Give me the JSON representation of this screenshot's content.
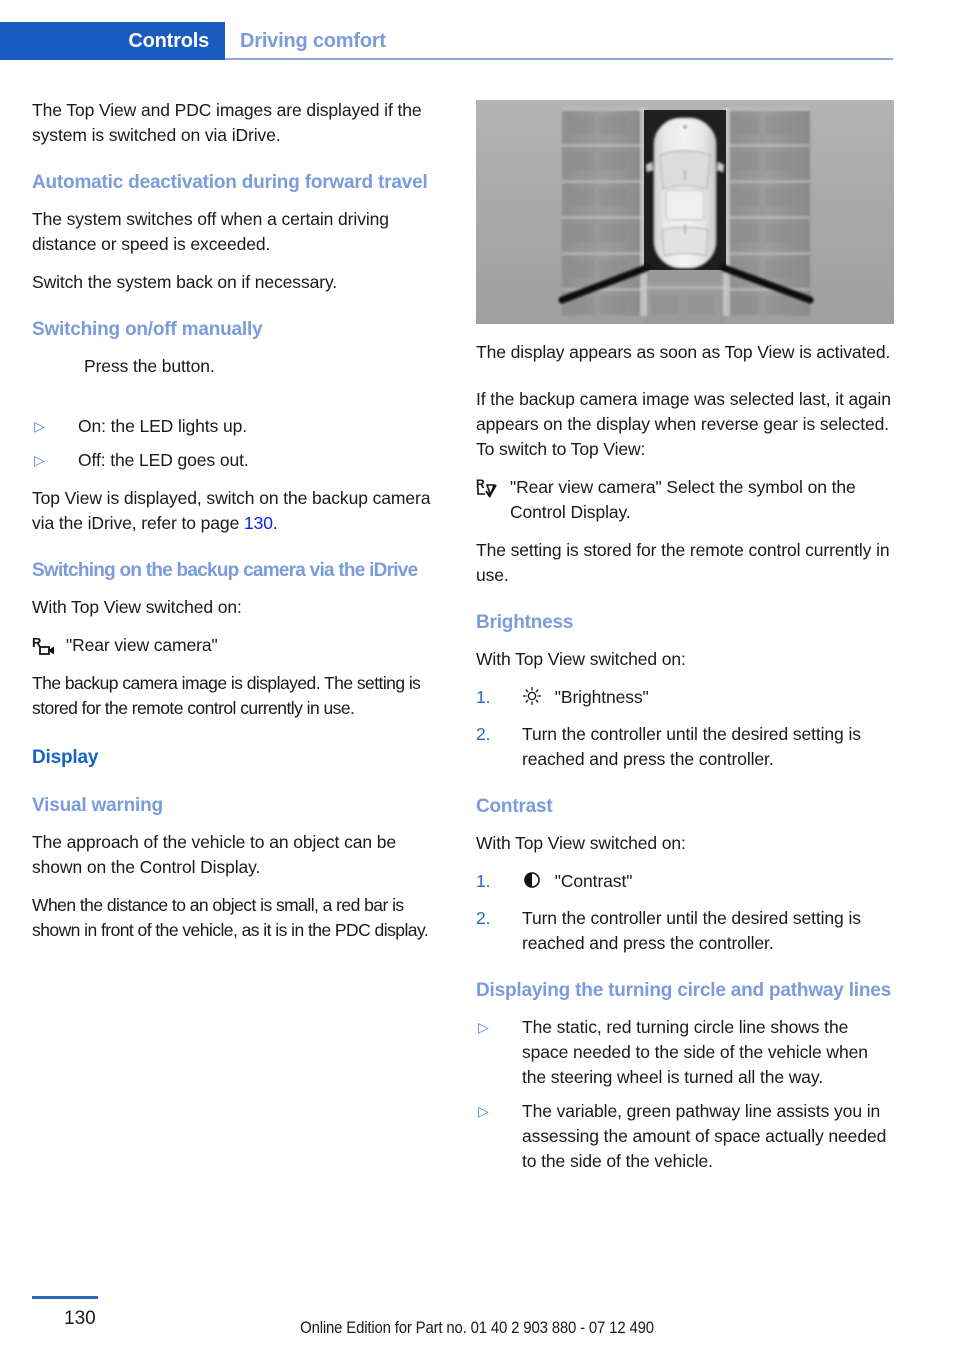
{
  "header": {
    "tab_label": "Controls",
    "section_label": "Driving comfort"
  },
  "left_column": {
    "intro_paragraph": "The Top View and PDC images are displayed if the system is switched on via iDrive.",
    "auto_deactivation": {
      "heading": "Automatic deactivation during forward travel",
      "paragraph_1": "The system switches off when a certain driving distance or speed is exceeded.",
      "paragraph_2": "Switch the system back on if necessary."
    },
    "switching_manually": {
      "heading": "Switching on/off manually",
      "button_instruction": "Press the button.",
      "bullets": [
        "On: the LED lights up.",
        "Off: the LED goes out."
      ],
      "note_before_link": "Top View is displayed, switch on the backup camera via the iDrive, refer to page ",
      "note_link": "130",
      "note_after_link": "."
    },
    "backup_camera_idrive": {
      "heading": "Switching on the backup camera via the iDrive",
      "precondition": "With Top View switched on:",
      "menu_item": "\"Rear view camera\"",
      "paragraph": "The backup camera image is displayed. The setting is stored for the remote control currently in use."
    },
    "display": {
      "heading": "Display",
      "visual_warning": {
        "heading": "Visual warning",
        "paragraph_1": "The approach of the vehicle to an object can be shown on the Control Display.",
        "paragraph_2": "When the distance to an object is small, a red bar is shown in front of the vehicle, as it is in the PDC display."
      }
    }
  },
  "right_column": {
    "figure_caption_paragraphs": [
      "The display appears as soon as Top View is activated.",
      "If the backup camera image was selected last, it again appears on the display when reverse gear is selected. To switch to Top View:"
    ],
    "rear_view_camera_step": "\"Rear view camera\" Select the symbol on the Control Display.",
    "setting_stored": "The setting is stored for the remote control currently in use.",
    "brightness": {
      "heading": "Brightness",
      "precondition": "With Top View switched on:",
      "steps": [
        {
          "number": "1.",
          "icon": "sun-icon",
          "text": "\"Brightness\""
        },
        {
          "number": "2.",
          "icon": "",
          "text": "Turn the controller until the desired setting is reached and press the controller."
        }
      ]
    },
    "contrast": {
      "heading": "Contrast",
      "precondition": "With Top View switched on:",
      "steps": [
        {
          "number": "1.",
          "icon": "contrast-icon",
          "text": "\"Contrast\""
        },
        {
          "number": "2.",
          "icon": "",
          "text": "Turn the controller until the desired setting is reached and press the controller."
        }
      ]
    },
    "turning_circle": {
      "heading": "Displaying the turning circle and pathway lines",
      "bullets": [
        "The static, red turning circle line shows the space needed to the side of the vehicle when the steering wheel is turned all the way.",
        "The variable, green pathway line assists you in assessing the amount of space actually needed to the side of the vehicle."
      ]
    }
  },
  "figure": {
    "alt": "Top View image of a vehicle between two walls with pathway lines"
  },
  "footer": {
    "page_number": "130",
    "edition_line": "Online Edition for Part no. 01 40 2 903 880 - 07 12 490"
  },
  "icons": {
    "pdc_button": "pdc-button-icon",
    "rear_view_camera": "rear-view-camera-icon",
    "rear_view_camera_selected": "rear-view-camera-selected-icon",
    "brightness": "sun-icon",
    "contrast": "contrast-half-circle-icon",
    "bullet": "triangle-bullet-icon"
  },
  "colors": {
    "tab_blue": "#1a5bbf",
    "heading_light_blue": "#7b9bdb",
    "heading_strong_blue": "#1565c0",
    "link_blue": "#0b23e8"
  }
}
